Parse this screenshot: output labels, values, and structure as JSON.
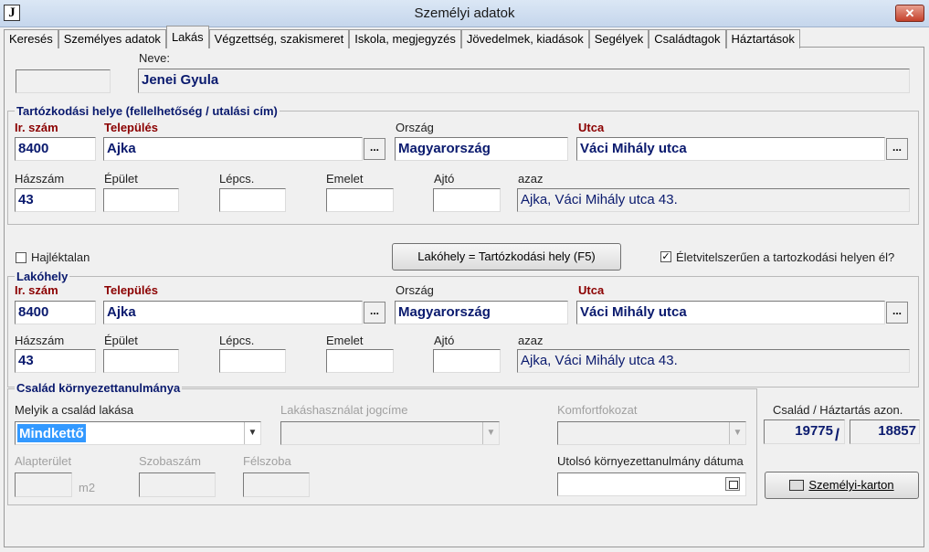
{
  "window": {
    "title": "Személyi adatok",
    "icon_letter": "J",
    "close_glyph": "✕"
  },
  "tabs": [
    {
      "label": "Keresés"
    },
    {
      "label": "Személyes adatok"
    },
    {
      "label": "Lakás"
    },
    {
      "label": "Végzettség, szakismeret"
    },
    {
      "label": "Iskola, megjegyzés"
    },
    {
      "label": "Jövedelmek, kiadások"
    },
    {
      "label": "Segélyek"
    },
    {
      "label": "Családtagok"
    },
    {
      "label": "Háztartások"
    }
  ],
  "name": {
    "label": "Neve:",
    "value": "Jenei Gyula"
  },
  "residence": {
    "title": "Tartózkodási helye (fellelhetőség / utalási cím)",
    "zip_label": "Ir. szám",
    "zip": "8400",
    "city_label": "Település",
    "city": "Ajka",
    "country_label": "Ország",
    "country": "Magyarország",
    "street_label": "Utca",
    "street": "Váci Mihály utca",
    "house_label": "Házszám",
    "house": "43",
    "building_label": "Épület",
    "building": "",
    "stairs_label": "Lépcs.",
    "stairs": "",
    "floor_label": "Emelet",
    "floor": "",
    "door_label": "Ajtó",
    "door": "",
    "summary_label": "azaz",
    "summary": "Ajka, Váci Mihály utca 43.",
    "ellipsis": "..."
  },
  "homeless": {
    "label": "Hajléktalan",
    "checked": false
  },
  "copy_button": {
    "label": "Lakóhely  = Tartózkodási hely (F5)"
  },
  "lives_there": {
    "label": "Életvitelszerűen a tartozkodási helyen él?",
    "checked": true,
    "check_glyph": "✓"
  },
  "home": {
    "title": "Lakóhely",
    "zip_label": "Ir. szám",
    "zip": "8400",
    "city_label": "Település",
    "city": "Ajka",
    "country_label": "Ország",
    "country": "Magyarország",
    "street_label": "Utca",
    "street": "Váci Mihály utca",
    "house_label": "Házszám",
    "house": "43",
    "building_label": "Épület",
    "building": "",
    "stairs_label": "Lépcs.",
    "stairs": "",
    "floor_label": "Emelet",
    "floor": "",
    "door_label": "Ajtó",
    "door": "",
    "summary_label": "azaz",
    "summary": "Ajka, Váci Mihály utca 43.",
    "ellipsis": "..."
  },
  "family_env": {
    "title": "Család környezettanulmánya",
    "whose_home_label": "Melyik a család lakása",
    "whose_home_value": "Mindkettő",
    "usage_label": "Lakáshasználat jogcíme",
    "comfort_label": "Komfortfokozat",
    "area_label": "Alapterület",
    "area_unit": "m2",
    "rooms_label": "Szobaszám",
    "halfrooms_label": "Félszoba",
    "last_study_label": "Utolsó környezettanulmány dátuma",
    "dropdown_glyph": "▼"
  },
  "ids": {
    "label": "Család / Háztartás azon.",
    "family_id": "19775",
    "separator": "/",
    "household_id": "18857"
  },
  "card_button": {
    "label": "Személyi-karton"
  },
  "colors": {
    "field_text": "#0a1a6e",
    "required_label": "#8b0000",
    "selection": "#3399ff"
  }
}
